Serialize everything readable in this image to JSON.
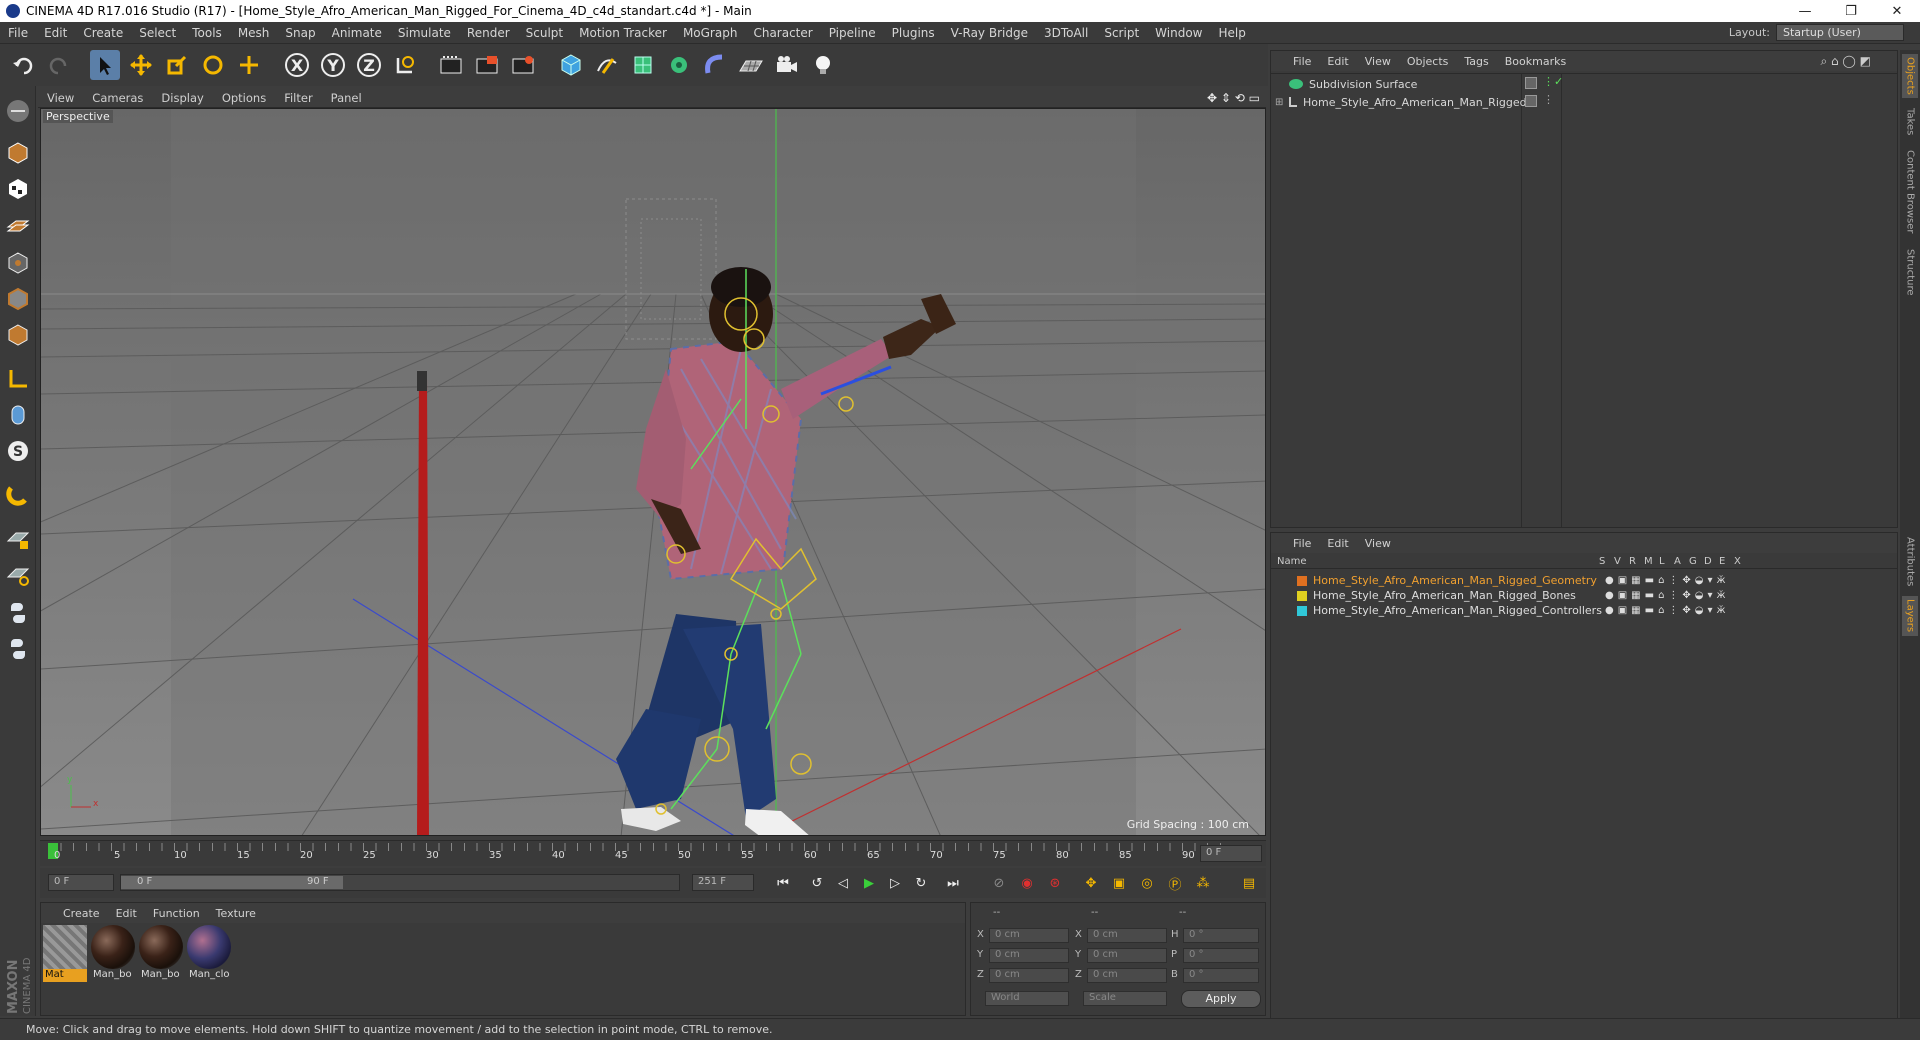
{
  "window": {
    "title": "CINEMA 4D R17.016 Studio (R17) - [Home_Style_Afro_American_Man_Rigged_For_Cinema_4D_c4d_standart.c4d *] - Main",
    "minimize": "—",
    "maximize": "❐",
    "close": "✕"
  },
  "menubar": {
    "items": [
      "File",
      "Edit",
      "Create",
      "Select",
      "Tools",
      "Mesh",
      "Snap",
      "Animate",
      "Simulate",
      "Render",
      "Sculpt",
      "Motion Tracker",
      "MoGraph",
      "Character",
      "Pipeline",
      "Plugins",
      "V-Ray Bridge",
      "3DToAll",
      "Script",
      "Window",
      "Help"
    ],
    "layout_label": "Layout:",
    "layout_value": "Startup (User)"
  },
  "toolbar": {
    "undo_icon": "undo-icon",
    "redo_icon": "redo-icon",
    "axis_x": "X",
    "axis_y": "Y",
    "axis_z": "Z"
  },
  "viewport": {
    "menu": [
      "View",
      "Cameras",
      "Display",
      "Options",
      "Filter",
      "Panel"
    ],
    "label": "Perspective",
    "grid_spacing": "Grid Spacing : 100 cm",
    "axis_y": "y",
    "axis_x": "x"
  },
  "object_manager": {
    "menu": [
      "File",
      "Edit",
      "View",
      "Objects",
      "Tags",
      "Bookmarks"
    ],
    "objects": [
      "Subdivision Surface",
      "Home_Style_Afro_American_Man_Rigged"
    ]
  },
  "layer_manager": {
    "menu": [
      "File",
      "Edit",
      "View"
    ],
    "header_name": "Name",
    "header_cols": [
      "S",
      "V",
      "R",
      "M",
      "L",
      "A",
      "G",
      "D",
      "E",
      "X"
    ],
    "layers": [
      {
        "name": "Home_Style_Afro_American_Man_Rigged_Geometry",
        "color": "#e07020",
        "highlight": true
      },
      {
        "name": "Home_Style_Afro_American_Man_Rigged_Bones",
        "color": "#e0d020",
        "highlight": false
      },
      {
        "name": "Home_Style_Afro_American_Man_Rigged_Controllers",
        "color": "#30c8d8",
        "highlight": false
      }
    ]
  },
  "side_tabs": [
    "Objects",
    "Takes",
    "Content Browser",
    "Structure",
    "Attributes",
    "Layers"
  ],
  "timeline": {
    "ticks": [
      "0",
      "5",
      "10",
      "15",
      "20",
      "25",
      "30",
      "35",
      "40",
      "45",
      "50",
      "55",
      "60",
      "65",
      "70",
      "75",
      "80",
      "85",
      "90"
    ],
    "current_frame": "0 F",
    "start_field": "0 F",
    "range_start": "0 F",
    "range_end": "90 F",
    "end_field": "251 F"
  },
  "material_manager": {
    "menu": [
      "Create",
      "Edit",
      "Function",
      "Texture"
    ],
    "materials": [
      "Mat",
      "Man_bo",
      "Man_bo",
      "Man_clo"
    ]
  },
  "coordinates": {
    "headers": [
      "--",
      "--",
      "--"
    ],
    "rows": [
      {
        "a": "X",
        "av": "0 cm",
        "b": "X",
        "bv": "0 cm",
        "c": "H",
        "cv": "0 °"
      },
      {
        "a": "Y",
        "av": "0 cm",
        "b": "Y",
        "bv": "0 cm",
        "c": "P",
        "cv": "0 °"
      },
      {
        "a": "Z",
        "av": "0 cm",
        "b": "Z",
        "bv": "0 cm",
        "c": "B",
        "cv": "0 °"
      }
    ],
    "world": "World",
    "scale": "Scale",
    "apply": "Apply"
  },
  "status": "Move: Click and drag to move elements. Hold down SHIFT to quantize movement / add to the selection in point mode, CTRL to remove.",
  "logo": {
    "maxon": "MAXON",
    "cinema": "CINEMA 4D"
  }
}
